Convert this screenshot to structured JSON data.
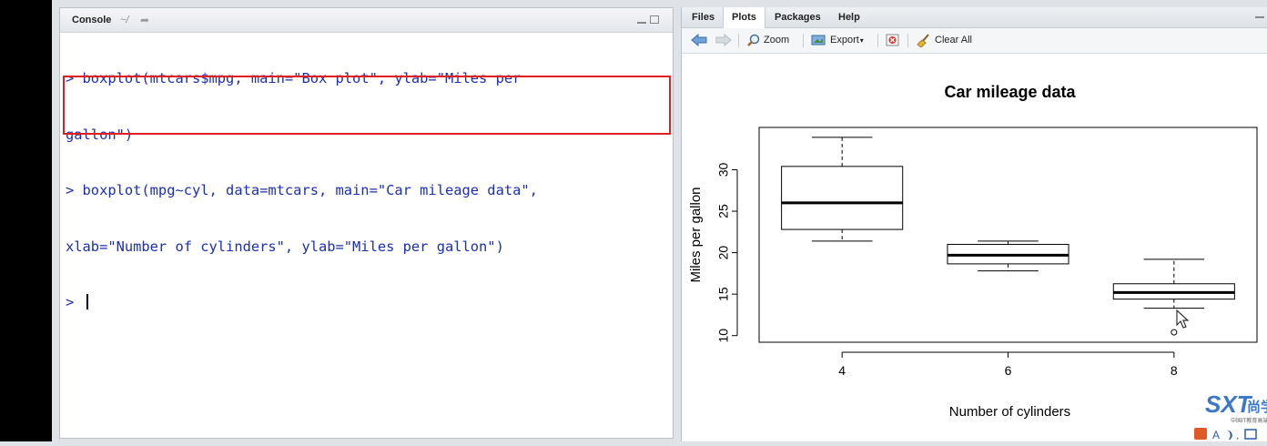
{
  "console": {
    "title": "Console",
    "path": "~/",
    "lines": [
      "> boxplot(mtcars$mpg, main=\"Box plot\", ylab=\"Miles per",
      "gallon\")",
      "> boxplot(mpg~cyl, data=mtcars, main=\"Car mileage data\",",
      "xlab=\"Number of cylinders\", ylab=\"Miles per gallon\")",
      "> "
    ]
  },
  "plots_pane": {
    "tabs": [
      "Files",
      "Plots",
      "Packages",
      "Help"
    ],
    "active_tab": "Plots",
    "toolbar": {
      "zoom_label": "Zoom",
      "export_label": "Export",
      "clear_all_label": "Clear All"
    }
  },
  "watermark": {
    "logo_text": "SXT",
    "logo_cn": "尚学",
    "subtitle": "中国IT教育高端领"
  },
  "colors": {
    "console_text": "#1a2fb5",
    "highlight_border": "#e02020",
    "watermark_blue": "#3b78c8"
  },
  "chart_data": {
    "type": "boxplot",
    "title": "Car mileage data",
    "xlabel": "Number of cylinders",
    "ylabel": "Miles per gallon",
    "categories": [
      "4",
      "6",
      "8"
    ],
    "yticks": [
      10,
      15,
      20,
      25,
      30
    ],
    "ylim": [
      9.2,
      35.1
    ],
    "boxes": [
      {
        "category": "4",
        "min": 21.4,
        "q1": 22.8,
        "median": 26.0,
        "q3": 30.4,
        "max": 33.9,
        "outliers": []
      },
      {
        "category": "6",
        "min": 17.8,
        "q1": 18.65,
        "median": 19.7,
        "q3": 21.0,
        "max": 21.4,
        "outliers": []
      },
      {
        "category": "8",
        "min": 13.3,
        "q1": 14.4,
        "median": 15.2,
        "q3": 16.25,
        "max": 19.2,
        "outliers": [
          10.4
        ]
      }
    ]
  }
}
